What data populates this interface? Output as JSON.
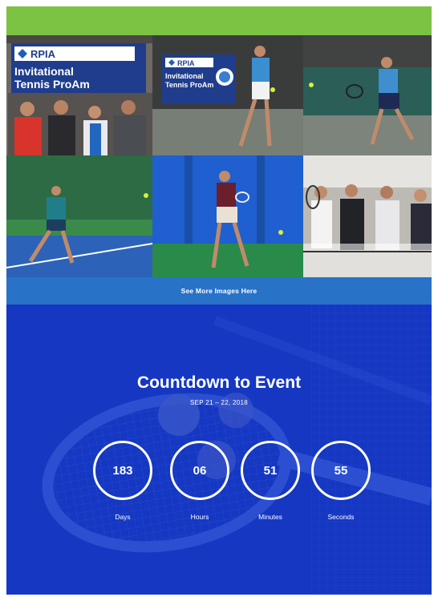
{
  "gallery": {
    "banner_logo": "RPIA",
    "banner_text_1": "Invitational",
    "banner_text_2": "Tennis ProAm",
    "banner_text_3": "Invitational",
    "banner_text_4": "Tennis ProAm"
  },
  "see_more": {
    "label": "See More Images Here"
  },
  "countdown": {
    "title": "Countdown to Event",
    "date": "SEP 21 – 22, 2018",
    "units": [
      {
        "value": "183",
        "label": "Days"
      },
      {
        "value": "06",
        "label": "Hours"
      },
      {
        "value": "51",
        "label": "Minutes"
      },
      {
        "value": "55",
        "label": "Seconds"
      }
    ]
  },
  "colors": {
    "top_bar": "#7cc243",
    "button": "#2873c8",
    "countdown_bg": "#1537c2"
  }
}
